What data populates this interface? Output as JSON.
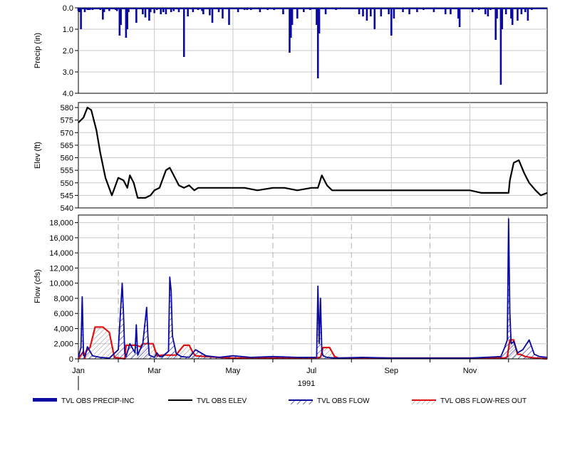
{
  "chart_data": [
    {
      "type": "bar",
      "ylabel": "Precip (in)",
      "ylim": [
        0,
        4.0
      ],
      "y_inverted": true,
      "yticks": [
        "0.0",
        "1.0",
        "2.0",
        "3.0",
        "4.0"
      ],
      "series": [
        {
          "name": "TVL OBS PRECIP-INC",
          "color": "#0a0a9e",
          "x": [
            "1991-01-01",
            "1991-01-02",
            "1991-01-03",
            "1991-01-06",
            "1991-01-08",
            "1991-01-09",
            "1991-01-10",
            "1991-01-12",
            "1991-01-18",
            "1991-01-20",
            "1991-01-21",
            "1991-01-25",
            "1991-01-30",
            "1991-01-31",
            "1991-02-02",
            "1991-02-03",
            "1991-02-07",
            "1991-02-08",
            "1991-02-09",
            "1991-02-15",
            "1991-02-20",
            "1991-02-22",
            "1991-02-25",
            "1991-02-26",
            "1991-03-01",
            "1991-03-03",
            "1991-03-06",
            "1991-03-08",
            "1991-03-10",
            "1991-03-14",
            "1991-03-16",
            "1991-03-20",
            "1991-03-24",
            "1991-03-27",
            "1991-03-31",
            "1991-04-04",
            "1991-04-07",
            "1991-04-08",
            "1991-04-13",
            "1991-04-15",
            "1991-04-20",
            "1991-04-23",
            "1991-04-28",
            "1991-05-05",
            "1991-05-10",
            "1991-05-12",
            "1991-05-15",
            "1991-05-22",
            "1991-05-28",
            "1991-06-02",
            "1991-06-09",
            "1991-06-14",
            "1991-06-15",
            "1991-06-16",
            "1991-06-20",
            "1991-06-25",
            "1991-06-30",
            "1991-07-05",
            "1991-07-06",
            "1991-07-07",
            "1991-07-12",
            "1991-07-20",
            "1991-08-07",
            "1991-08-10",
            "1991-08-13",
            "1991-08-16",
            "1991-08-19",
            "1991-08-24",
            "1991-08-30",
            "1991-09-01",
            "1991-09-03",
            "1991-09-10",
            "1991-09-15",
            "1991-09-21",
            "1991-09-26",
            "1991-10-04",
            "1991-10-13",
            "1991-10-17",
            "1991-10-23",
            "1991-10-24",
            "1991-11-03",
            "1991-11-08",
            "1991-11-13",
            "1991-11-15",
            "1991-11-17",
            "1991-11-21",
            "1991-11-22",
            "1991-11-25",
            "1991-11-26",
            "1991-11-29",
            "1991-12-03",
            "1991-12-04",
            "1991-12-08",
            "1991-12-11",
            "1991-12-14",
            "1991-12-16",
            "1991-12-19"
          ],
          "values": [
            0.15,
            0.2,
            1.0,
            0.2,
            0.1,
            0.1,
            0.1,
            0.1,
            0.1,
            0.55,
            0.2,
            0.15,
            0.1,
            0.15,
            1.3,
            0.8,
            1.4,
            1.0,
            0.2,
            0.7,
            0.3,
            0.45,
            0.6,
            0.2,
            0.25,
            0.1,
            0.3,
            0.2,
            0.3,
            0.2,
            0.15,
            0.2,
            2.3,
            0.4,
            0.2,
            0.1,
            0.15,
            0.3,
            0.35,
            0.7,
            0.2,
            0.5,
            0.8,
            0.2,
            0.1,
            0.1,
            0.1,
            0.2,
            0.1,
            0.1,
            0.3,
            2.1,
            1.4,
            0.8,
            0.5,
            0.2,
            0.1,
            0.8,
            3.3,
            1.2,
            0.3,
            0.1,
            0.3,
            0.4,
            0.6,
            0.4,
            1.0,
            0.4,
            0.3,
            1.3,
            0.5,
            0.2,
            0.3,
            0.2,
            0.1,
            0.2,
            0.3,
            0.3,
            0.5,
            0.9,
            0.2,
            0.1,
            0.3,
            0.4,
            0.1,
            1.5,
            0.5,
            3.6,
            1.0,
            0.3,
            0.5,
            0.8,
            0.6,
            0.3,
            0.2,
            0.6,
            0.1
          ]
        }
      ]
    },
    {
      "type": "line",
      "ylabel": "Elev (ft)",
      "ylim": [
        540,
        582
      ],
      "yticks": [
        "540",
        "545",
        "550",
        "555",
        "560",
        "565",
        "570",
        "575",
        "580"
      ],
      "series": [
        {
          "name": "TVL OBS ELEV",
          "color": "#000000",
          "x": [
            "1991-01-01",
            "1991-01-05",
            "1991-01-08",
            "1991-01-11",
            "1991-01-15",
            "1991-01-18",
            "1991-01-22",
            "1991-01-27",
            "1991-02-01",
            "1991-02-05",
            "1991-02-08",
            "1991-02-10",
            "1991-02-13",
            "1991-02-16",
            "1991-02-19",
            "1991-02-22",
            "1991-02-26",
            "1991-03-01",
            "1991-03-05",
            "1991-03-10",
            "1991-03-13",
            "1991-03-16",
            "1991-03-18",
            "1991-03-20",
            "1991-03-24",
            "1991-03-28",
            "1991-04-01",
            "1991-04-04",
            "1991-04-08",
            "1991-04-14",
            "1991-04-20",
            "1991-04-28",
            "1991-05-10",
            "1991-05-20",
            "1991-06-01",
            "1991-06-10",
            "1991-06-20",
            "1991-07-01",
            "1991-07-03",
            "1991-07-06",
            "1991-07-09",
            "1991-07-13",
            "1991-07-17",
            "1991-07-25",
            "1991-08-10",
            "1991-09-01",
            "1991-10-01",
            "1991-10-15",
            "1991-11-01",
            "1991-11-10",
            "1991-11-17",
            "1991-11-28",
            "1991-12-01",
            "1991-12-02",
            "1991-12-05",
            "1991-12-09",
            "1991-12-13",
            "1991-12-17",
            "1991-12-22",
            "1991-12-26",
            "1991-12-31"
          ],
          "values": [
            574,
            576,
            580,
            579,
            571,
            562,
            552,
            545,
            552,
            551,
            548,
            553,
            550,
            544,
            544,
            544,
            545,
            547,
            548,
            555,
            556,
            553,
            551,
            549,
            548,
            549,
            547,
            548,
            548,
            548,
            548,
            548,
            548,
            547,
            548,
            548,
            547,
            548,
            548,
            548,
            553,
            549,
            547,
            547,
            547,
            547,
            547,
            547,
            547,
            546,
            546,
            546,
            546,
            551,
            558,
            559,
            554,
            550,
            547,
            545,
            546
          ]
        }
      ]
    },
    {
      "type": "line",
      "ylabel": "Flow (cfs)",
      "ylim": [
        0,
        19000
      ],
      "yticks": [
        "0",
        "2,000",
        "4,000",
        "6,000",
        "8,000",
        "10,000",
        "12,000",
        "14,000",
        "16,000",
        "18,000"
      ],
      "series": [
        {
          "name": "TVL OBS FLOW",
          "color": "#0a0a9e",
          "fill": "hatched",
          "x": [
            "1991-01-01",
            "1991-01-03",
            "1991-01-04",
            "1991-01-05",
            "1991-01-06",
            "1991-01-08",
            "1991-01-12",
            "1991-01-18",
            "1991-01-25",
            "1991-02-01",
            "1991-02-04",
            "1991-02-05",
            "1991-02-06",
            "1991-02-07",
            "1991-02-10",
            "1991-02-14",
            "1991-02-15",
            "1991-02-16",
            "1991-02-20",
            "1991-02-23",
            "1991-02-24",
            "1991-02-25",
            "1991-03-01",
            "1991-03-03",
            "1991-03-05",
            "1991-03-07",
            "1991-03-12",
            "1991-03-13",
            "1991-03-14",
            "1991-03-15",
            "1991-03-18",
            "1991-03-22",
            "1991-03-28",
            "1991-04-02",
            "1991-04-10",
            "1991-04-20",
            "1991-05-01",
            "1991-05-15",
            "1991-06-01",
            "1991-06-20",
            "1991-07-05",
            "1991-07-06",
            "1991-07-07",
            "1991-07-08",
            "1991-07-09",
            "1991-07-10",
            "1991-07-13",
            "1991-07-20",
            "1991-08-10",
            "1991-09-01",
            "1991-10-01",
            "1991-11-01",
            "1991-11-25",
            "1991-11-28",
            "1991-11-30",
            "1991-12-01",
            "1991-12-02",
            "1991-12-03",
            "1991-12-05",
            "1991-12-08",
            "1991-12-12",
            "1991-12-17",
            "1991-12-21",
            "1991-12-25",
            "1991-12-31"
          ],
          "values": [
            200,
            1500,
            8200,
            500,
            300,
            1600,
            400,
            200,
            100,
            1200,
            10000,
            6000,
            800,
            300,
            2000,
            800,
            4500,
            500,
            2000,
            6800,
            3000,
            500,
            200,
            800,
            300,
            300,
            1000,
            10800,
            9000,
            3000,
            700,
            300,
            200,
            1200,
            400,
            200,
            400,
            200,
            300,
            200,
            200,
            9600,
            2000,
            8000,
            1000,
            400,
            200,
            100,
            200,
            100,
            100,
            100,
            300,
            1500,
            2500,
            18500,
            6000,
            2000,
            2300,
            800,
            1200,
            2500,
            600,
            300,
            200
          ]
        },
        {
          "name": "TVL OBS FLOW-RES OUT",
          "color": "#e01010",
          "fill": "hatched",
          "x": [
            "1991-01-01",
            "1991-01-05",
            "1991-01-06",
            "1991-01-07",
            "1991-01-10",
            "1991-01-14",
            "1991-01-20",
            "1991-01-25",
            "1991-01-28",
            "1991-01-29",
            "1991-02-06",
            "1991-02-07",
            "1991-02-10",
            "1991-02-15",
            "1991-02-18",
            "1991-02-20",
            "1991-02-24",
            "1991-02-28",
            "1991-03-03",
            "1991-03-07",
            "1991-03-10",
            "1991-03-14",
            "1991-03-18",
            "1991-03-20",
            "1991-03-24",
            "1991-03-28",
            "1991-03-31",
            "1991-04-02",
            "1991-04-10",
            "1991-04-20",
            "1991-05-01",
            "1991-05-15",
            "1991-06-01",
            "1991-06-20",
            "1991-07-01",
            "1991-07-08",
            "1991-07-10",
            "1991-07-15",
            "1991-07-19",
            "1991-07-22",
            "1991-08-10",
            "1991-09-01",
            "1991-10-01",
            "1991-11-01",
            "1991-11-20",
            "1991-11-28",
            "1991-11-30",
            "1991-12-02",
            "1991-12-05",
            "1991-12-08",
            "1991-12-10",
            "1991-12-14",
            "1991-12-18",
            "1991-12-22",
            "1991-12-31"
          ],
          "values": [
            0,
            1000,
            100,
            1000,
            1500,
            4200,
            4200,
            3500,
            1000,
            200,
            0,
            1800,
            1800,
            1800,
            1600,
            2000,
            2000,
            2000,
            400,
            500,
            500,
            500,
            500,
            1000,
            1800,
            1800,
            800,
            400,
            300,
            200,
            100,
            100,
            100,
            100,
            100,
            200,
            1500,
            1500,
            300,
            100,
            100,
            100,
            100,
            100,
            100,
            100,
            300,
            2500,
            2500,
            600,
            600,
            300,
            200,
            100,
            0
          ]
        }
      ]
    }
  ],
  "xaxis": {
    "range": [
      "1991-01-01",
      "1991-12-31"
    ],
    "tick_labels": [
      "Jan",
      "Mar",
      "May",
      "Jul",
      "Sep",
      "Nov"
    ],
    "year_label": "1991"
  },
  "legend": {
    "placement": "bottom",
    "items": [
      {
        "label": "TVL OBS PRECIP-INC",
        "color": "#0a0a9e",
        "style": "thick"
      },
      {
        "label": "TVL OBS ELEV",
        "color": "#000000",
        "style": "line"
      },
      {
        "label": "TVL OBS FLOW",
        "color": "#0a0a9e",
        "style": "hatch"
      },
      {
        "label": "TVL OBS FLOW-RES OUT",
        "color": "#e01010",
        "style": "hatch"
      }
    ]
  }
}
